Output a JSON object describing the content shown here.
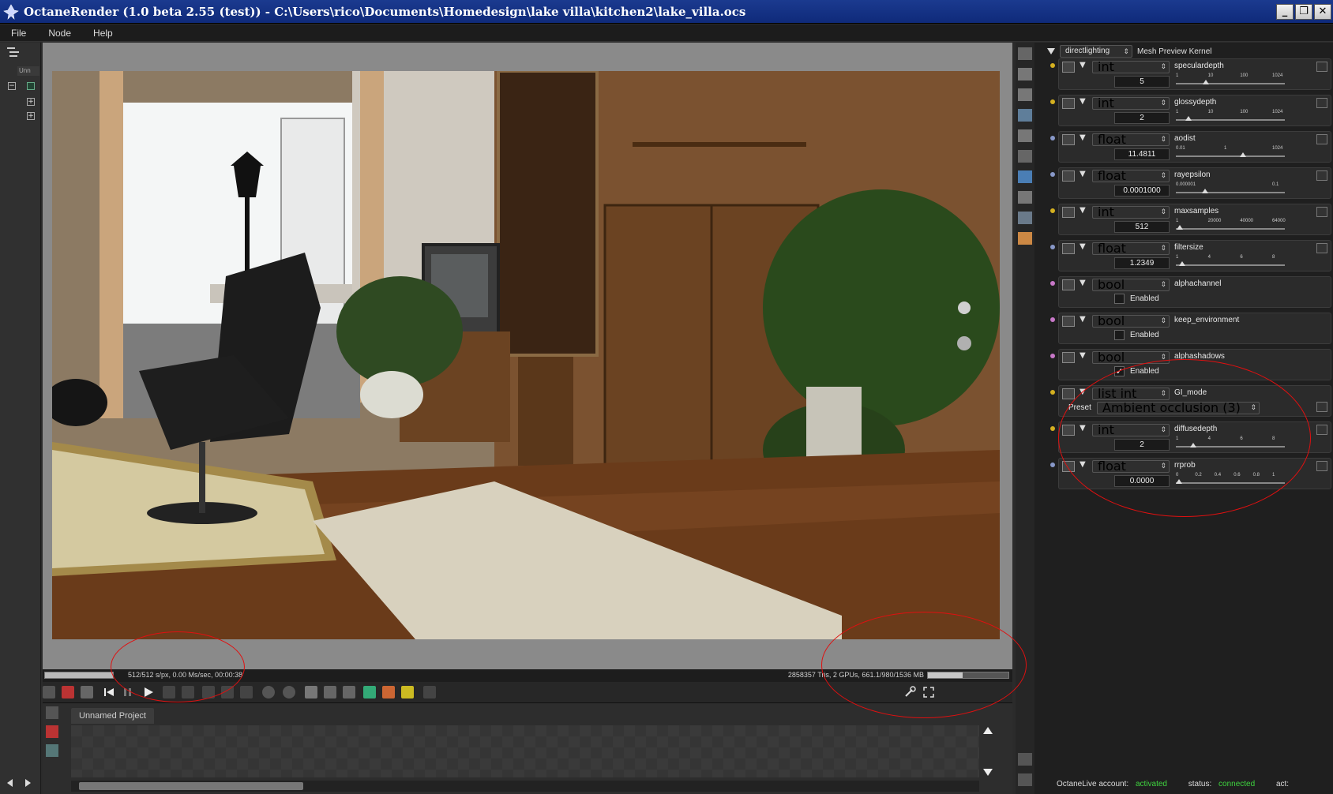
{
  "window": {
    "title": "OctaneRender (1.0 beta 2.55 (test)) - C:\\Users\\rico\\Documents\\Homedesign\\lake villa\\kitchen2\\lake_villa.ocs",
    "controls": [
      "_",
      "❐",
      "✕"
    ]
  },
  "menu": [
    "File",
    "Node",
    "Help"
  ],
  "left_strip": {
    "header": "Unn"
  },
  "status": {
    "progress_fraction": 1.0,
    "left": "512/512 s/px, 0.00 Ms/sec, 00:00:38",
    "right": "2858357 Tris, 2 GPUs, 661.1/980/1536 MB",
    "memory_fraction": 0.43
  },
  "outliner": {
    "tab": "Unnamed Project"
  },
  "kernel": {
    "type": "directlighting",
    "label": "Mesh Preview Kernel"
  },
  "params": [
    {
      "kind": "slider",
      "type": "int",
      "name": "speculardepth",
      "value": "5",
      "ticks": [
        "1",
        "10",
        "100",
        "1024"
      ],
      "pos": 0.26,
      "dot": "#d4b020"
    },
    {
      "kind": "slider",
      "type": "int",
      "name": "glossydepth",
      "value": "2",
      "ticks": [
        "1",
        "10",
        "100",
        "1024"
      ],
      "pos": 0.09,
      "dot": "#d4b020"
    },
    {
      "kind": "slider",
      "type": "float",
      "name": "aodist",
      "value": "11.4811",
      "ticks": [
        "0.01",
        "1",
        "1024"
      ],
      "pos": 0.62,
      "dot": "#8898c8"
    },
    {
      "kind": "slider",
      "type": "float",
      "name": "rayepsilon",
      "value": "0.0001000",
      "ticks": [
        "0.000001",
        "0.1"
      ],
      "pos": 0.25,
      "dot": "#8898c8"
    },
    {
      "kind": "slider",
      "type": "int",
      "name": "maxsamples",
      "value": "512",
      "ticks": [
        "1",
        "20000",
        "40000",
        "64000"
      ],
      "pos": 0.01,
      "dot": "#d4b020"
    },
    {
      "kind": "slider",
      "type": "float",
      "name": "filtersize",
      "value": "1.2349",
      "ticks": [
        "1",
        "4",
        "6",
        "8"
      ],
      "pos": 0.03,
      "dot": "#8898c8"
    },
    {
      "kind": "bool",
      "type": "bool",
      "name": "alphachannel",
      "checked": false,
      "label": "Enabled",
      "dot": "#c878c8"
    },
    {
      "kind": "bool",
      "type": "bool",
      "name": "keep_environment",
      "checked": false,
      "label": "Enabled",
      "dot": "#c878c8"
    },
    {
      "kind": "bool",
      "type": "bool",
      "name": "alphashadows",
      "checked": true,
      "label": "Enabled",
      "dot": "#c878c8"
    },
    {
      "kind": "list",
      "type": "list int",
      "name": "GI_mode",
      "preset_label": "Preset",
      "preset": "Ambient occlusion (3)",
      "dot": "#d4b020"
    },
    {
      "kind": "slider",
      "type": "int",
      "name": "diffusedepth",
      "value": "2",
      "ticks": [
        "1",
        "4",
        "6",
        "8"
      ],
      "pos": 0.14,
      "dot": "#d4b020"
    },
    {
      "kind": "slider",
      "type": "float",
      "name": "rrprob",
      "value": "0.0000",
      "ticks": [
        "0",
        "0.2",
        "0.4",
        "0.6",
        "0.8",
        "1"
      ],
      "pos": 0.0,
      "dot": "#8898c8"
    }
  ],
  "account": {
    "label": "OctaneLive account:",
    "account_status": "activated",
    "status_label": "status:",
    "status": "connected",
    "act_label": "act:"
  }
}
